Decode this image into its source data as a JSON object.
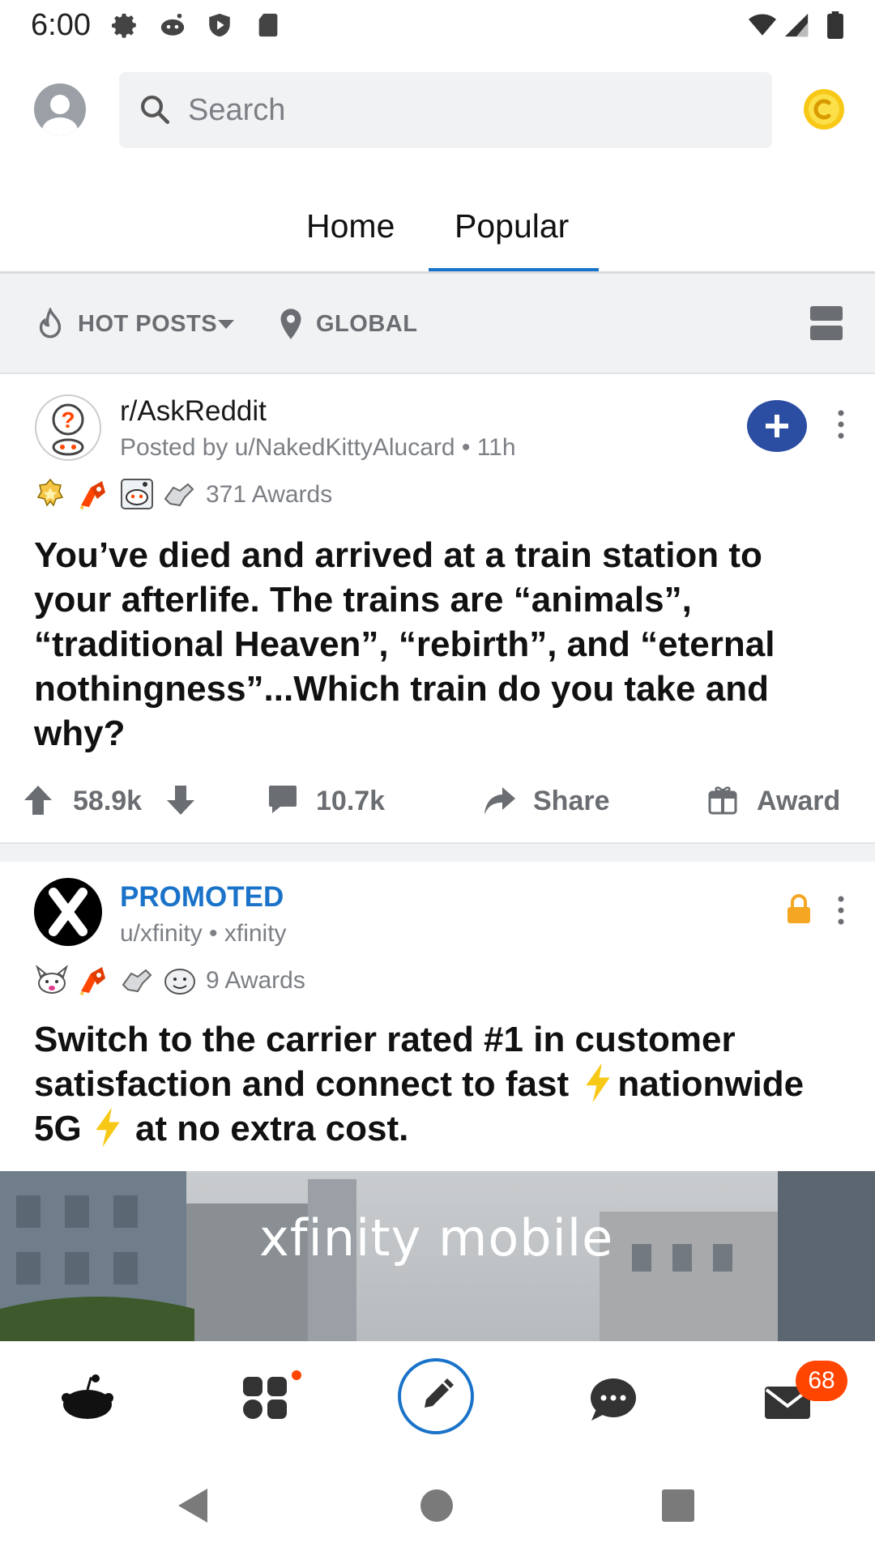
{
  "status_bar": {
    "time": "6:00"
  },
  "header": {
    "search_placeholder": "Search"
  },
  "tabs": [
    {
      "label": "Home",
      "active": false
    },
    {
      "label": "Popular",
      "active": true
    }
  ],
  "sort_bar": {
    "sort_label": "HOT POSTS",
    "location_label": "GLOBAL"
  },
  "posts": [
    {
      "subreddit": "r/AskReddit",
      "meta": "Posted by u/NakedKittyAlucard • 11h",
      "awards": "371 Awards",
      "title": "You’ve died and arrived at a train station to your afterlife. The trains are “animals”, “traditional Heaven”, “rebirth”, and “eternal nothingness”...Which train do you take and why?",
      "upvotes": "58.9k",
      "comments": "10.7k",
      "share_label": "Share",
      "award_label": "Award"
    },
    {
      "promoted_label": "PROMOTED",
      "meta": "u/xfinity • xfinity",
      "awards": "9 Awards",
      "title_line1": "Switch to the carrier rated #1 in customer",
      "title_line2a": "satisfaction and connect to fast",
      "title_line2b": "nationwide",
      "title_line3a": "5G",
      "title_line3b": "at no extra cost.",
      "ad_logo": "xfinity mobile"
    }
  ],
  "bottom_nav": {
    "inbox_badge": "68"
  },
  "colors": {
    "accent_blue": "#1a73c9",
    "join_button": "#2b4ea2",
    "badge_orange": "#ff4500",
    "lock_yellow": "#f5a623"
  }
}
